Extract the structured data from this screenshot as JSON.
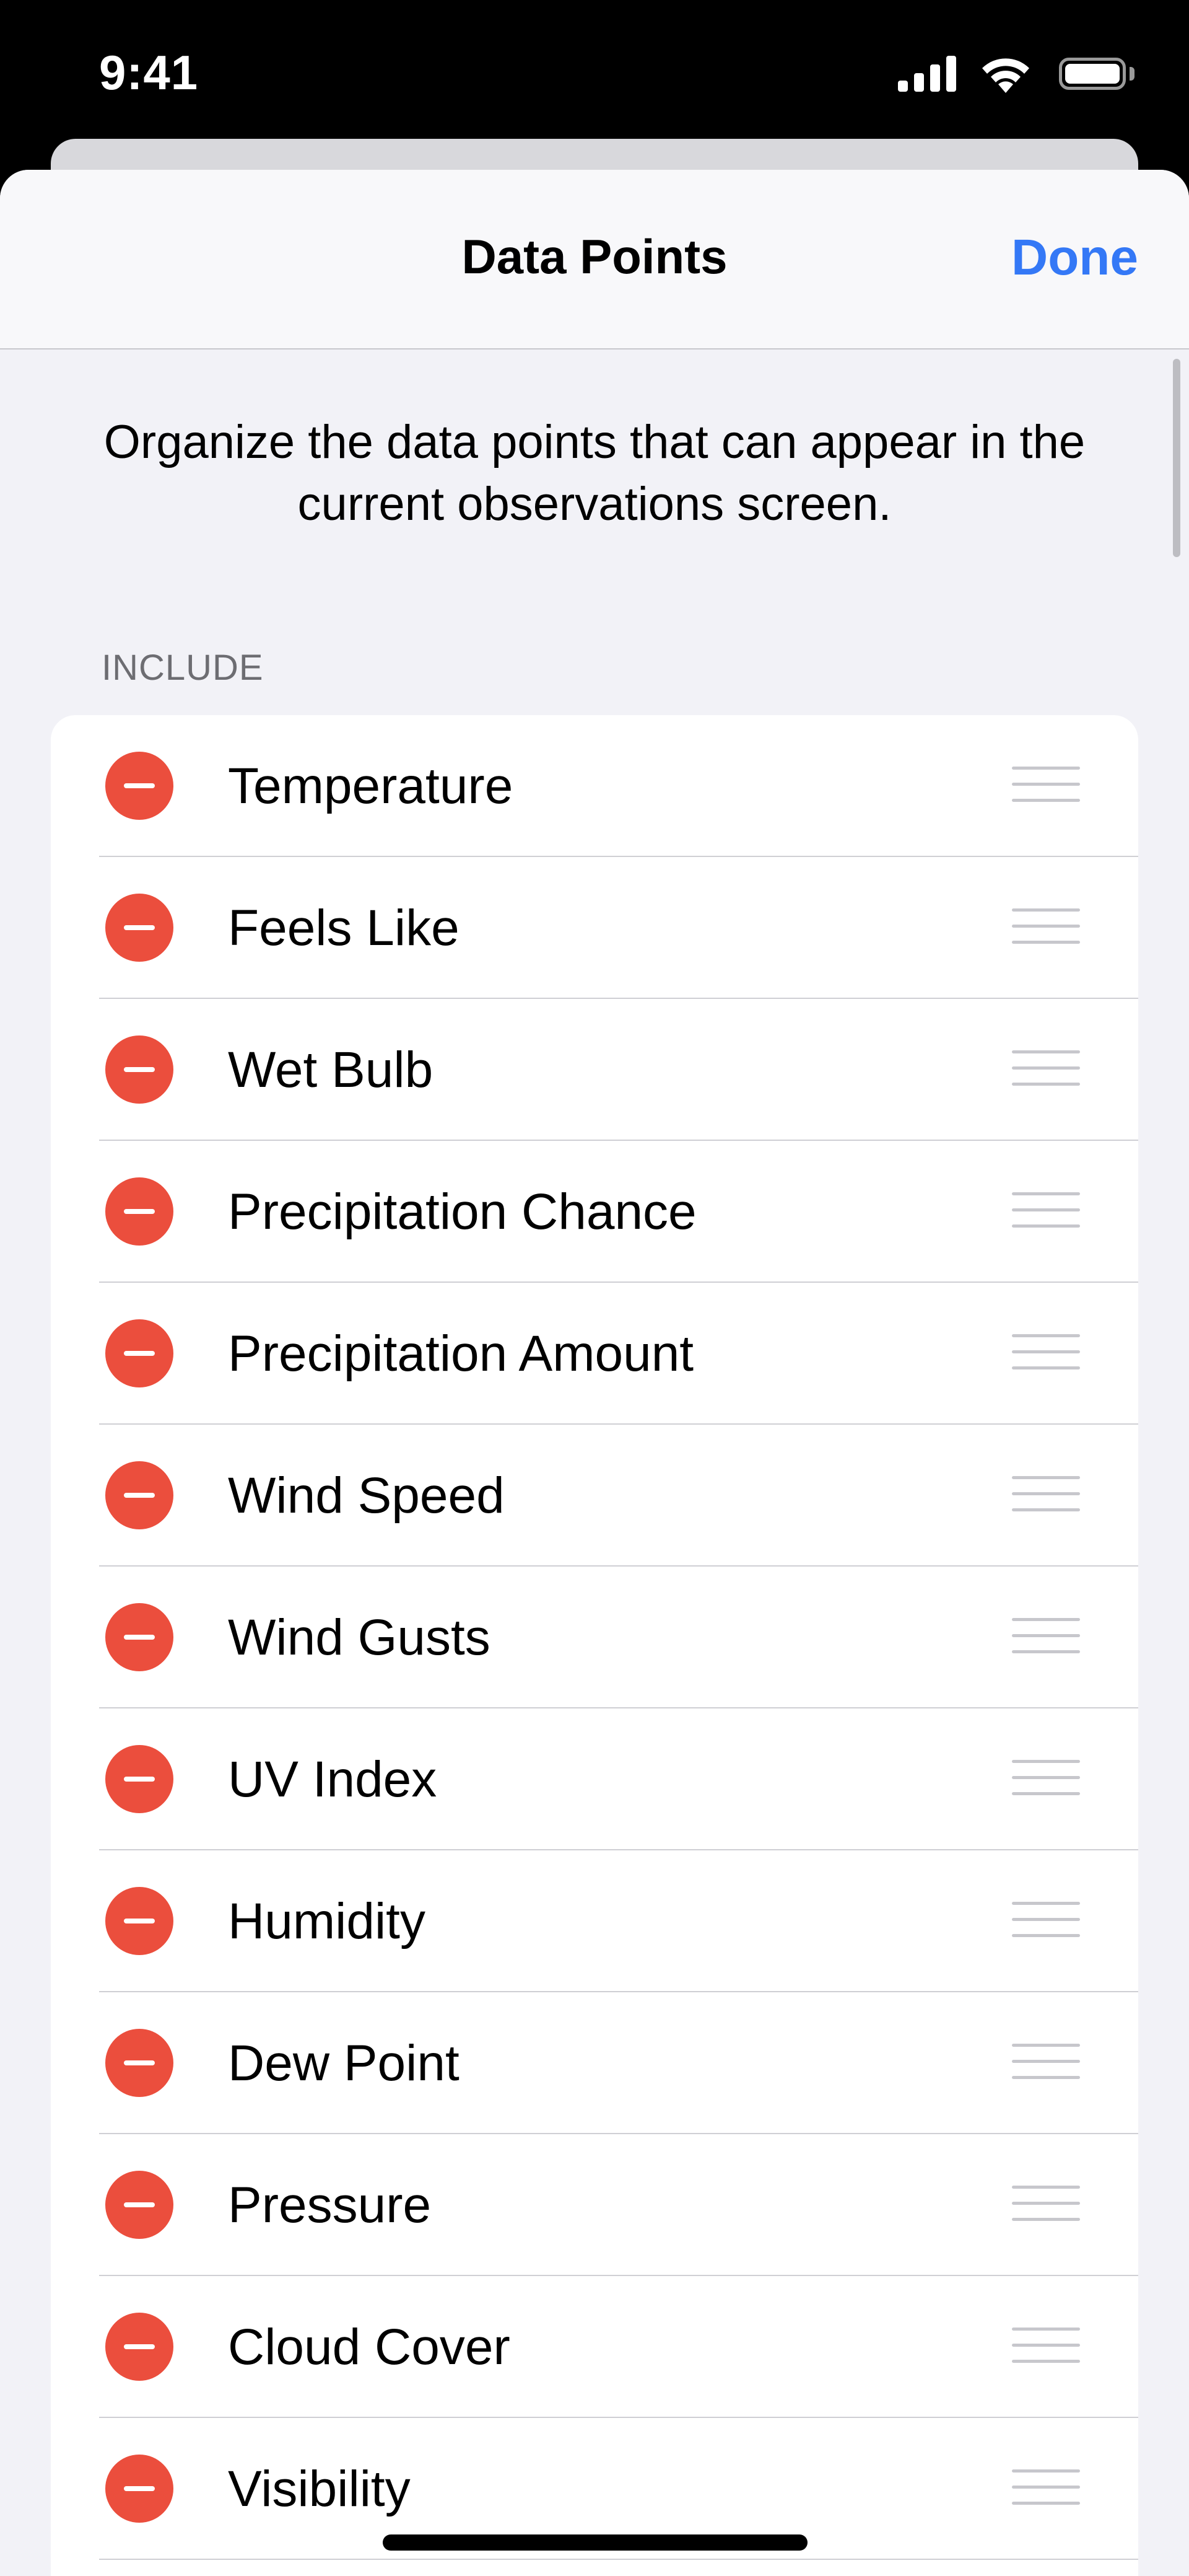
{
  "status_bar": {
    "time": "9:41"
  },
  "nav": {
    "title": "Data Points",
    "done_label": "Done"
  },
  "description": "Organize the data points that can appear in the current observations screen.",
  "section": {
    "header": "INCLUDE",
    "items": [
      {
        "label": "Temperature"
      },
      {
        "label": "Feels Like"
      },
      {
        "label": "Wet Bulb"
      },
      {
        "label": "Precipitation Chance"
      },
      {
        "label": "Precipitation Amount"
      },
      {
        "label": "Wind Speed"
      },
      {
        "label": "Wind Gusts"
      },
      {
        "label": "UV Index"
      },
      {
        "label": "Humidity"
      },
      {
        "label": "Dew Point"
      },
      {
        "label": "Pressure"
      },
      {
        "label": "Cloud Cover"
      },
      {
        "label": "Visibility"
      }
    ]
  },
  "colors": {
    "accent": "#3478f6",
    "delete": "#eb4e3d",
    "background": "#f2f2f7",
    "card": "#ffffff"
  }
}
